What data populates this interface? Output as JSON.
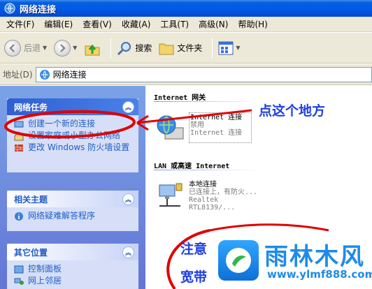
{
  "window": {
    "title": "网络连接"
  },
  "menu": [
    "文件(F)",
    "编辑(E)",
    "查看(V)",
    "收藏(A)",
    "工具(T)",
    "高级(N)",
    "帮助(H)"
  ],
  "toolbar": {
    "back_label": "后退",
    "search_label": "搜索",
    "folders_label": "文件夹"
  },
  "address": {
    "label": "地址(D)",
    "value": "网络连接"
  },
  "tasks": {
    "network": {
      "title": "网络任务",
      "items": [
        "创建一个新的连接",
        "设置家庭或小型办公网络",
        "更改 Windows 防火墙设置"
      ]
    },
    "related": {
      "title": "相关主题",
      "items": [
        "网络疑难解答程序"
      ]
    },
    "other": {
      "title": "其它位置",
      "items": [
        "控制面板",
        "网上邻居"
      ]
    }
  },
  "groups": {
    "internet": {
      "header": "Internet 网关",
      "name": "Internet 连接",
      "status": "禁用",
      "device": "Internet 连接"
    },
    "lan": {
      "header": "LAN 或高速 Internet",
      "name": "本地连接",
      "status": "已连接上，有防火...",
      "device": "Realtek RTL8139/..."
    }
  },
  "annotations": {
    "click_here": "点这个地方",
    "note": "注意",
    "broadband": "宽带"
  },
  "watermark": {
    "brand": "雨林木风",
    "url": "www.ylmf888.com"
  },
  "colors": {
    "title_bar": "#0058e6",
    "task_pane": "#6f8fe0",
    "link": "#215dc6",
    "annotation": "#1f3fe0",
    "marker": "#e00000"
  }
}
